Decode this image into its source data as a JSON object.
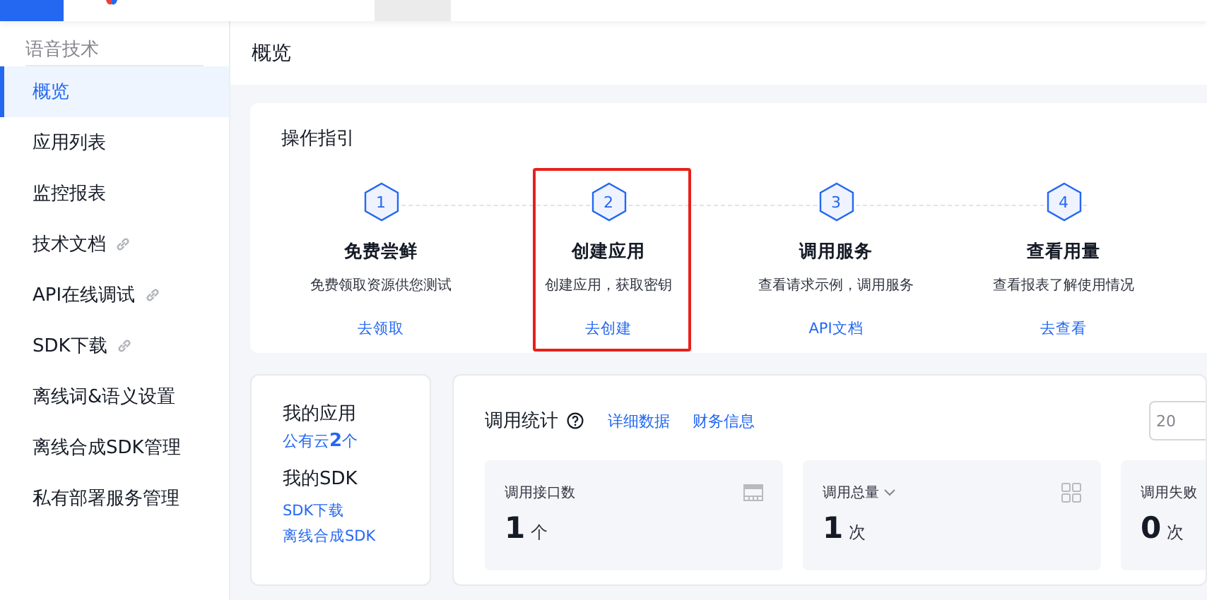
{
  "sidebar": {
    "title": "语音技术",
    "items": [
      {
        "label": "概览",
        "selected": true,
        "external": false
      },
      {
        "label": "应用列表",
        "selected": false,
        "external": false
      },
      {
        "label": "监控报表",
        "selected": false,
        "external": false
      },
      {
        "label": "技术文档",
        "selected": false,
        "external": true
      },
      {
        "label": "API在线调试",
        "selected": false,
        "external": true
      },
      {
        "label": "SDK下载",
        "selected": false,
        "external": true
      },
      {
        "label": "离线词&语义设置",
        "selected": false,
        "external": false
      },
      {
        "label": "离线合成SDK管理",
        "selected": false,
        "external": false
      },
      {
        "label": "私有部署服务管理",
        "selected": false,
        "external": false
      }
    ]
  },
  "header": {
    "title": "概览"
  },
  "guide": {
    "title": "操作指引",
    "steps": [
      {
        "number": "1",
        "title": "免费尝鲜",
        "description": "免费领取资源供您测试",
        "link": "去领取",
        "highlighted": false
      },
      {
        "number": "2",
        "title": "创建应用",
        "description": "创建应用，获取密钥",
        "link": "去创建",
        "highlighted": true
      },
      {
        "number": "3",
        "title": "调用服务",
        "description": "查看请求示例，调用服务",
        "link": "API文档",
        "highlighted": false
      },
      {
        "number": "4",
        "title": "查看用量",
        "description": "查看报表了解使用情况",
        "link": "去查看",
        "highlighted": false
      }
    ]
  },
  "my_apps": {
    "title": "我的应用",
    "count_text": "公有云**2**个",
    "sdk_title": "我的SDK",
    "sdk_links": [
      "SDK下载",
      "离线合成SDK"
    ]
  },
  "stats": {
    "title": "调用统计",
    "links": [
      "详细数据",
      "财务信息"
    ],
    "date_field": "20",
    "metrics": [
      {
        "label": "调用接口数",
        "value": "1",
        "unit": "个",
        "kind": "table",
        "dropdown": false
      },
      {
        "label": "调用总量",
        "value": "1",
        "unit": "次",
        "kind": "grid",
        "dropdown": true
      },
      {
        "label": "调用失败",
        "value": "0",
        "unit": "次",
        "kind": "none",
        "dropdown": false
      }
    ]
  }
}
